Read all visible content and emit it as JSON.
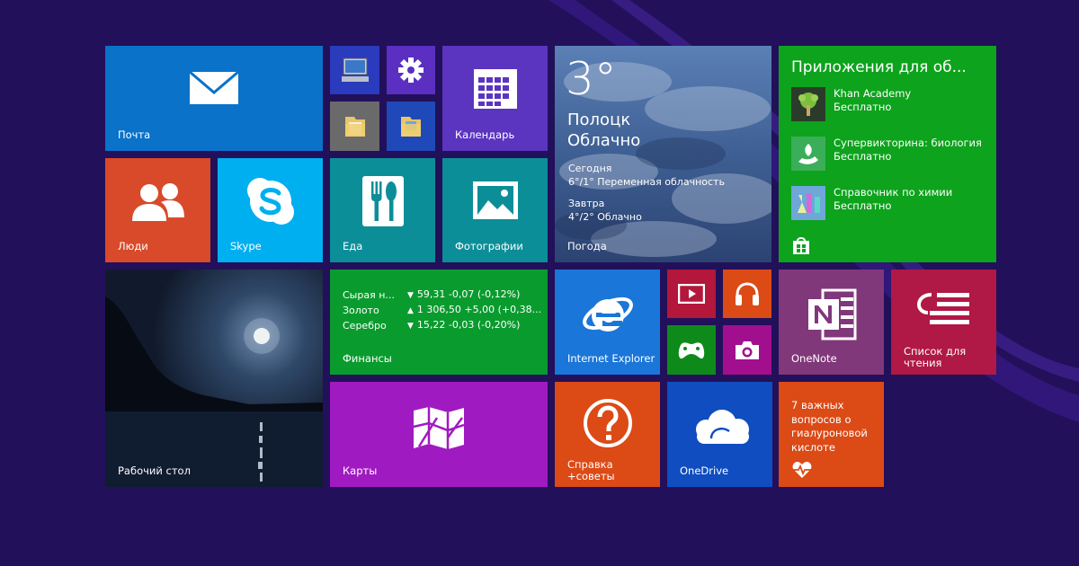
{
  "tiles": {
    "mail": {
      "label": "Почта",
      "color": "#0a72c9",
      "icon": "envelope-icon"
    },
    "desktop_pc": {
      "icon": "computer-icon",
      "color": "#2a3bbd"
    },
    "settings": {
      "icon": "gear-icon",
      "color": "#5a2fc1"
    },
    "documents": {
      "icon": "folder-icon",
      "color": "#6a6a6a"
    },
    "files": {
      "icon": "folder-icon",
      "color": "#1f49b8"
    },
    "calendar": {
      "label": "Календарь",
      "color": "#5b34c0",
      "icon": "calendar-icon"
    },
    "people": {
      "label": "Люди",
      "color": "#d84a2a",
      "icon": "people-icon"
    },
    "skype": {
      "label": "Skype",
      "color": "#00aff0",
      "icon": "skype-icon"
    },
    "food": {
      "label": "Еда",
      "color": "#0c8e98",
      "icon": "fork-knife-icon"
    },
    "photos": {
      "label": "Фотографии",
      "color": "#0c8e98",
      "icon": "picture-icon"
    },
    "desktop": {
      "label": "Рабочий стол",
      "color": "#16223c"
    },
    "finance": {
      "label": "Финансы",
      "color": "#0a9b2e",
      "rows": [
        {
          "name": "Сырая н...",
          "arrow": "▼",
          "value": "59,31 -0,07 (-0,12%)"
        },
        {
          "name": "Золото",
          "arrow": "▲",
          "value": "1 306,50 +5,00 (+0,38..."
        },
        {
          "name": "Серебро",
          "arrow": "▼",
          "value": "15,22 -0,03 (-0,20%)"
        }
      ]
    },
    "maps": {
      "label": "Карты",
      "color": "#a01ac1",
      "icon": "map-icon"
    },
    "weather": {
      "label": "Погода",
      "temp": "3°",
      "city": "Полоцк",
      "condition": "Облачно",
      "today_label": "Сегодня",
      "today": "6°/1° Переменная облачность",
      "tomorrow_label": "Завтра",
      "tomorrow": "4°/2° Облачно"
    },
    "store": {
      "title": "Приложения для об...",
      "color": "#0da31c",
      "icon": "store-bag-icon",
      "apps": [
        {
          "name": "Khan Academy",
          "price": "Бесплатно"
        },
        {
          "name": "Супервикторина: биология",
          "price": "Бесплатно"
        },
        {
          "name": "Справочник по химии",
          "price": "Бесплатно"
        }
      ]
    },
    "ie": {
      "label": "Internet Explorer",
      "color": "#1a76d8",
      "icon": "internet-explorer-icon"
    },
    "video": {
      "icon": "video-icon",
      "color": "#b3173b"
    },
    "music": {
      "icon": "headphones-icon",
      "color": "#dc4a16"
    },
    "games": {
      "icon": "game-controller-icon",
      "color": "#0e8a1a"
    },
    "camera": {
      "icon": "camera-icon",
      "color": "#a10f8f"
    },
    "onenote": {
      "label": "OneNote",
      "color": "#80387a",
      "icon": "onenote-icon"
    },
    "reading": {
      "label": "Список для\nчтения",
      "label_line1": "Список для",
      "label_line2": "чтения",
      "color": "#b01845",
      "icon": "reading-list-icon"
    },
    "help": {
      "label_line1": "Справка",
      "label_line2": "+советы",
      "color": "#dc4a16",
      "icon": "question-mark-icon"
    },
    "onedrive": {
      "label": "OneDrive",
      "color": "#0f4dc0",
      "icon": "cloud-icon"
    },
    "health": {
      "text": "7 важных вопросов о гиалуроновой кислоте",
      "color": "#dc4a16",
      "icon": "heart-pulse-icon"
    }
  }
}
